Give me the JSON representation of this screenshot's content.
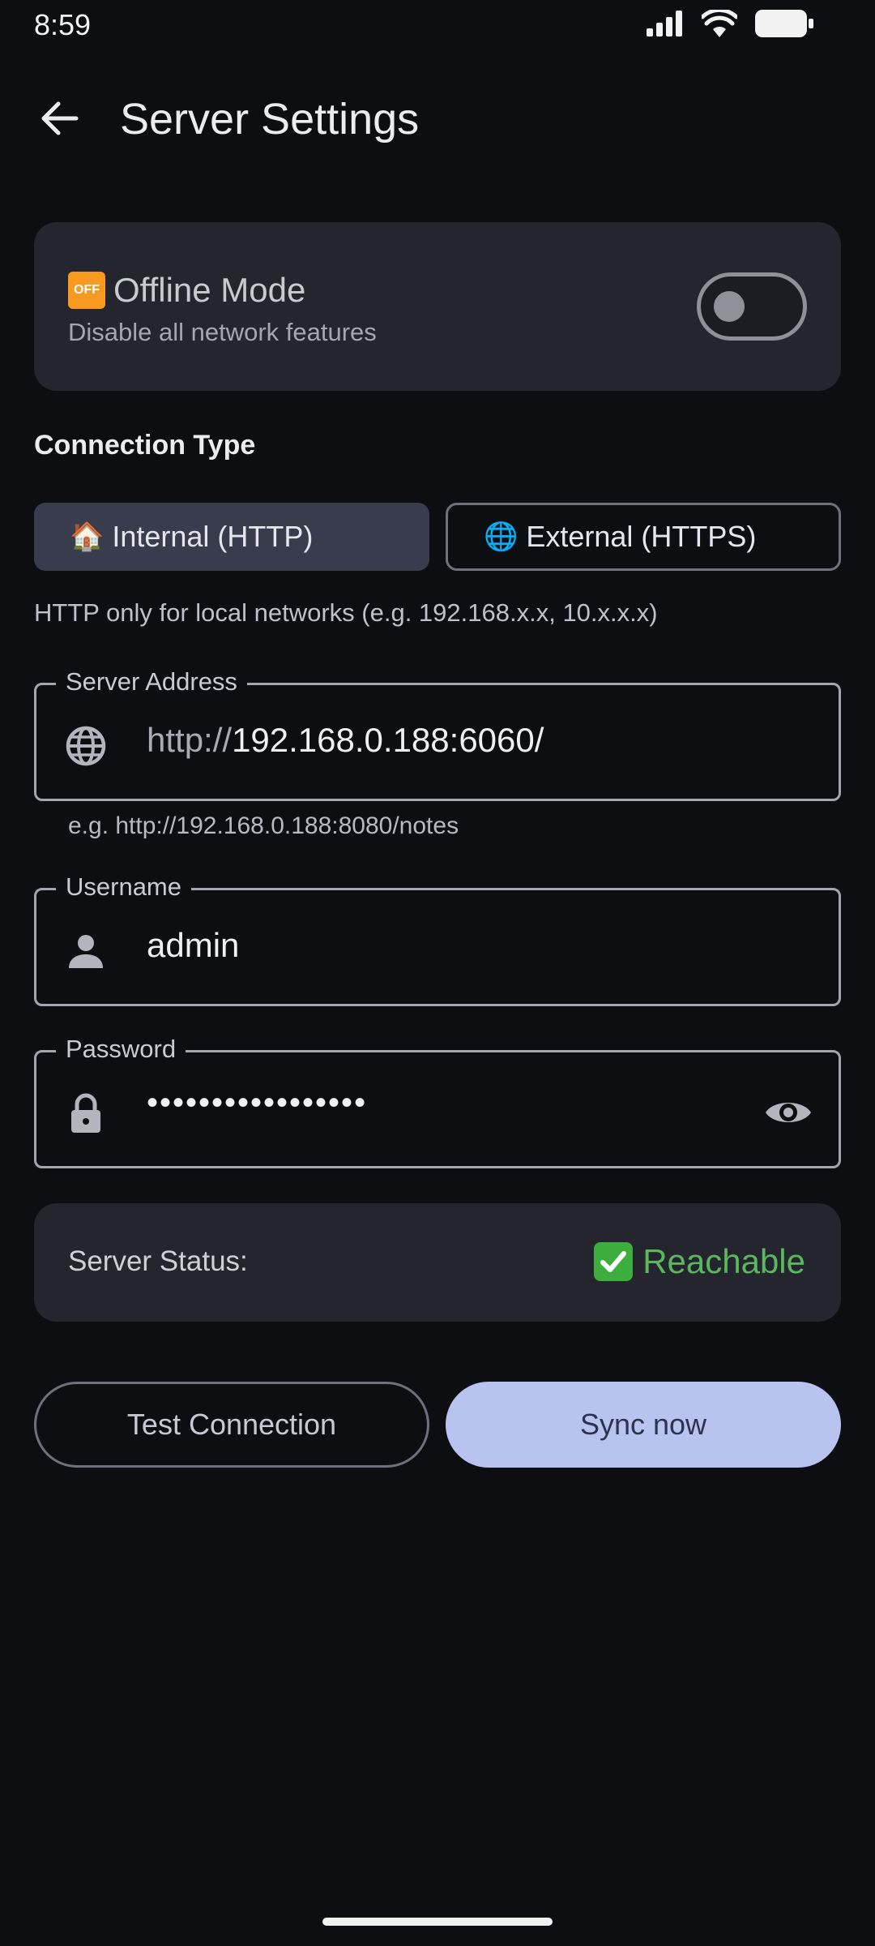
{
  "status_bar": {
    "time": "8:59"
  },
  "app_bar": {
    "title": "Server Settings"
  },
  "offline_mode": {
    "badge_text": "OFF",
    "title": "Offline Mode",
    "subtitle": "Disable all network features",
    "enabled": false
  },
  "connection_type": {
    "label": "Connection Type",
    "options": [
      {
        "emoji": "🏠",
        "label": "Internal (HTTP)",
        "selected": true
      },
      {
        "emoji": "🌐",
        "label": "External (HTTPS)",
        "selected": false
      }
    ],
    "hint": "HTTP only for local networks (e.g. 192.168.x.x, 10.x.x.x)"
  },
  "server_address": {
    "label": "Server Address",
    "prefix": "http://",
    "value": "192.168.0.188:6060/",
    "helper": "e.g. http://192.168.0.188:8080/notes",
    "icon": "globe-icon"
  },
  "username": {
    "label": "Username",
    "value": "admin",
    "icon": "person-icon"
  },
  "password": {
    "label": "Password",
    "masked_value": "•••••••••••••••••",
    "icon": "lock-icon"
  },
  "server_status": {
    "label": "Server Status:",
    "value": "Reachable",
    "color": "#59b85c"
  },
  "actions": {
    "test_label": "Test Connection",
    "sync_label": "Sync now"
  },
  "colors": {
    "background": "#0d0e12",
    "card": "#24252e",
    "accent": "#b9c3ef",
    "success": "#3dae3d"
  }
}
